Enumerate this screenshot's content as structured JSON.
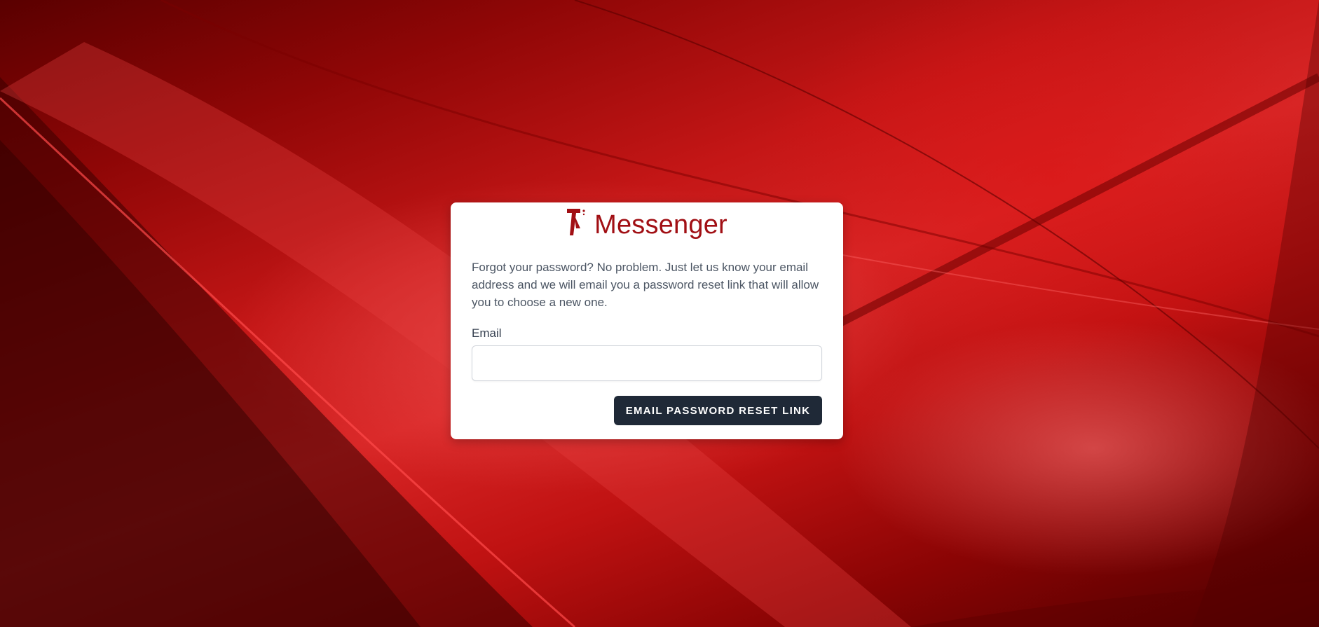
{
  "brand": {
    "name": "Messenger",
    "logo_icon": "t-logo-icon",
    "color": "#a10f14"
  },
  "forgot_password": {
    "intro": "Forgot your password? No problem. Just let us know your email address and we will email you a password reset link that will allow you to choose a new one.",
    "email_label": "Email",
    "email_value": "",
    "submit_label": "EMAIL PASSWORD RESET LINK"
  },
  "colors": {
    "background_accent": "#c41616",
    "button": "#1f2937"
  }
}
